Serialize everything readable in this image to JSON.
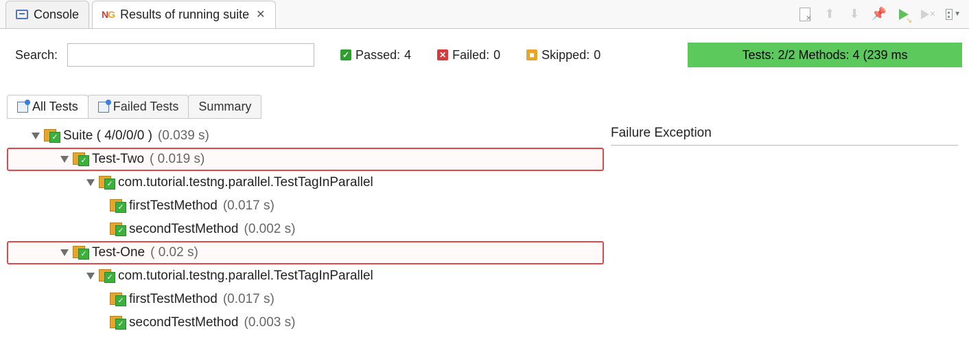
{
  "topTabs": {
    "console": "Console",
    "results": "Results of running suite"
  },
  "search": {
    "label": "Search:",
    "value": ""
  },
  "stats": {
    "passed": {
      "label": "Passed:",
      "value": "4"
    },
    "failed": {
      "label": "Failed:",
      "value": "0"
    },
    "skipped": {
      "label": "Skipped:",
      "value": "0"
    }
  },
  "testsBar": "Tests: 2/2  Methods: 4 (239 ms",
  "innerTabs": {
    "all": "All Tests",
    "failed": "Failed Tests",
    "summary": "Summary"
  },
  "detail": {
    "header": "Failure Exception"
  },
  "tree": {
    "suite": {
      "label": "Suite ( 4/0/0/0 )",
      "time": "(0.039 s)"
    },
    "testTwo": {
      "label": "Test-Two",
      "time": "( 0.019 s)"
    },
    "cls": "com.tutorial.testng.parallel.TestTagInParallel",
    "m1": {
      "label": "firstTestMethod",
      "time": "(0.017 s)"
    },
    "m2": {
      "label": "secondTestMethod",
      "time": "(0.002 s)"
    },
    "testOne": {
      "label": "Test-One",
      "time": "( 0.02 s)"
    },
    "m3": {
      "label": "firstTestMethod",
      "time": "(0.017 s)"
    },
    "m4": {
      "label": "secondTestMethod",
      "time": "(0.003 s)"
    }
  }
}
